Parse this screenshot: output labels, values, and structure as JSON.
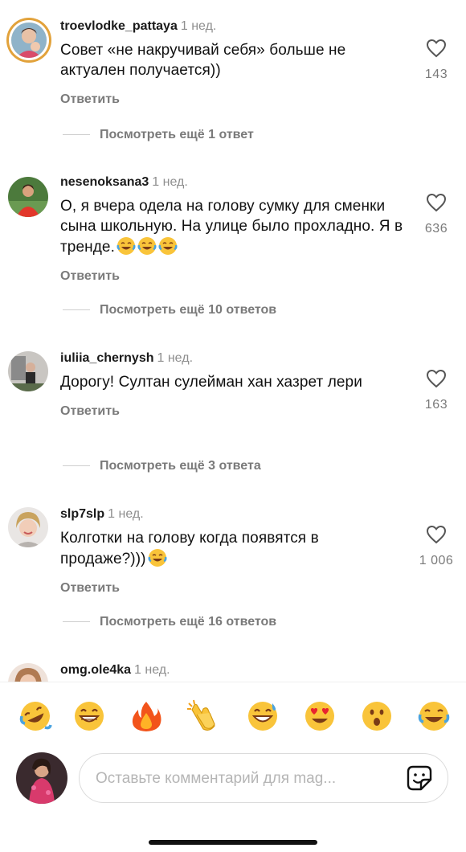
{
  "comments": [
    {
      "username": "troevlodke_pattaya",
      "time": "1 нед.",
      "text": "Совет «не накручивай себя» больше не актуален получается))",
      "likes": "143",
      "reply_label": "Ответить",
      "more_replies": "Посмотреть ещё 1 ответ",
      "emoji_after_text": 0
    },
    {
      "username": "nesenoksana3",
      "time": "1 нед.",
      "text": "О, я вчера одела на голову сумку для сменки сына школьную. На улице было прохладно. Я в тренде.",
      "likes": "636",
      "reply_label": "Ответить",
      "more_replies": "Посмотреть ещё 10 ответов",
      "emoji_after_text": 3
    },
    {
      "username": "iuliia_chernysh",
      "time": "1 нед.",
      "text": "Дорогу! Султан сулейман хан хазрет лери",
      "likes": "163",
      "reply_label": "Ответить",
      "more_replies": "Посмотреть ещё 3 ответа",
      "emoji_after_text": 0
    },
    {
      "username": "slp7slp",
      "time": "1 нед.",
      "text": "Колготки на голову когда появятся в продаже?)))",
      "likes": "1 006",
      "reply_label": "Ответить",
      "more_replies": "Посмотреть ещё 16 ответов",
      "emoji_after_text": 1
    },
    {
      "username": "omg.ole4ka",
      "time": "1 нед."
    }
  ],
  "reactions": [
    "rofl-emoji",
    "grin-emoji",
    "fire-emoji",
    "clapping-emoji",
    "sweat-smile-emoji",
    "heart-eyes-emoji",
    "astonished-emoji",
    "tears-of-joy-emoji"
  ],
  "composer": {
    "placeholder": "Оставьте комментарий для mag..."
  }
}
